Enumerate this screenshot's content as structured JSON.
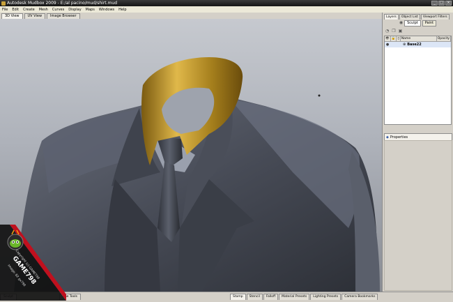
{
  "window": {
    "title": "Autodesk Mudbox 2009 - E:/al pacino/mud/shirt.mud"
  },
  "menu": [
    "File",
    "Edit",
    "Create",
    "Mesh",
    "Curves",
    "Display",
    "Maps",
    "Windows",
    "Help"
  ],
  "view_tabs": [
    "3D View",
    "UV View",
    "Image Browser"
  ],
  "right_panel": {
    "tabs": [
      "Layers",
      "Object List",
      "Viewport Filters"
    ],
    "mode_buttons": [
      "Sculpt",
      "Paint"
    ],
    "columns": [
      "Name",
      "Opacity"
    ],
    "layer_name": "Base22",
    "properties_label": "Properties"
  },
  "bottom": {
    "left_tabs": [
      "Sculpt",
      "one Tools"
    ],
    "right_tabs": [
      "Stamp",
      "Stencil",
      "Falloff",
      "Material Presets",
      "Lighting Presets",
      "Camera Bookmarks"
    ]
  },
  "watermark": {
    "brand": "GAME798",
    "line1": "Copyright (c) GAME798",
    "line2": "Image: B2 gx798"
  },
  "colors": {
    "suit": "#4b4f5a",
    "collar": "#b8901e",
    "viewport_bg": "#aeb2ba"
  }
}
